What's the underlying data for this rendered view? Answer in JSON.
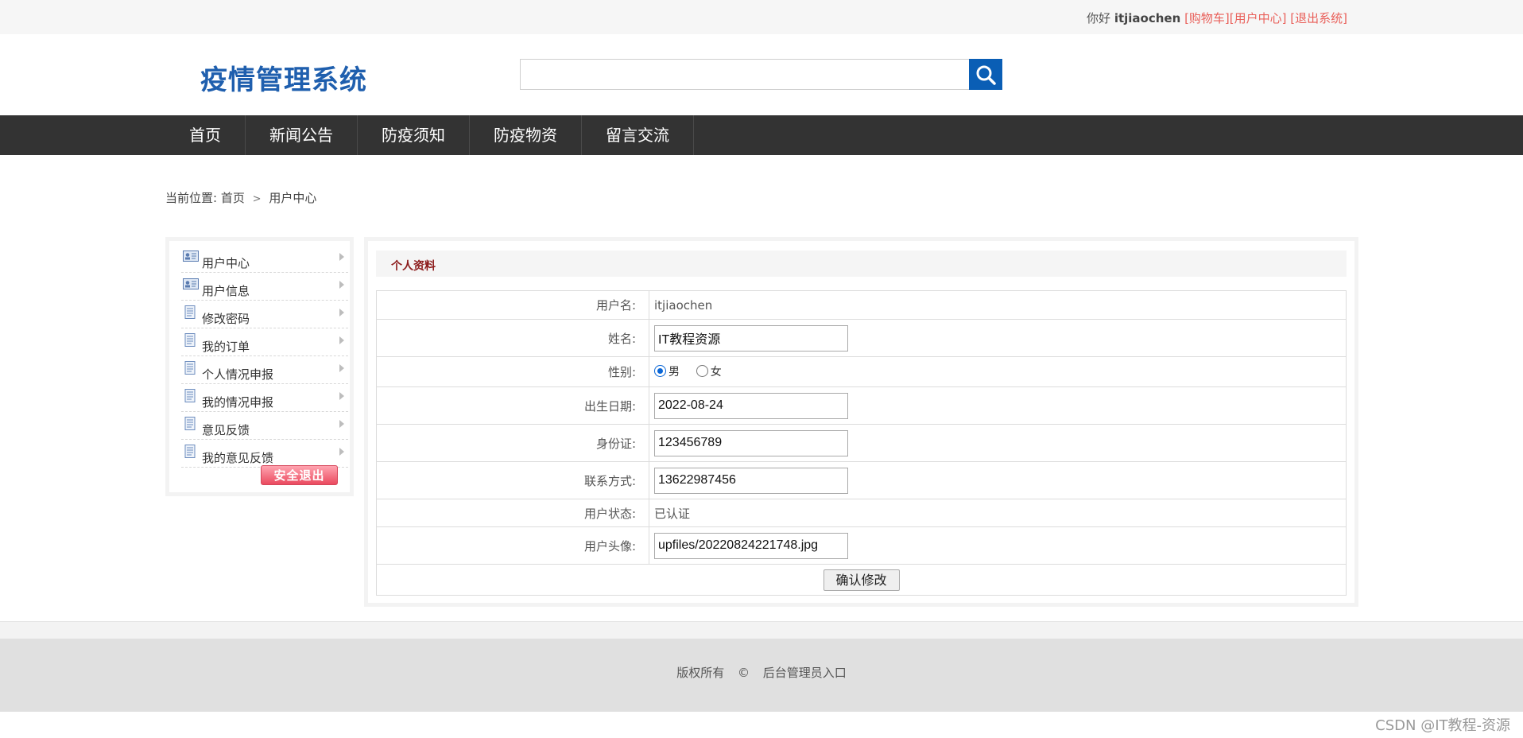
{
  "topbar": {
    "greeting": "你好",
    "username": "itjiaochen",
    "links": [
      "[购物车]",
      "[用户中心]",
      "[退出系统]"
    ]
  },
  "header": {
    "logo": "疫情管理系统",
    "search_placeholder": "",
    "search_icon": "search-icon"
  },
  "nav": {
    "items": [
      "首页",
      "新闻公告",
      "防疫须知",
      "防疫物资",
      "留言交流"
    ]
  },
  "breadcrumb": {
    "prefix": "当前位置:",
    "home": "首页",
    "separator": ">",
    "current": "用户中心"
  },
  "sidebar": {
    "items": [
      {
        "label": "用户中心",
        "icon": "user-card-icon"
      },
      {
        "label": "用户信息",
        "icon": "user-card-icon"
      },
      {
        "label": "修改密码",
        "icon": "document-icon"
      },
      {
        "label": "我的订单",
        "icon": "document-icon"
      },
      {
        "label": "个人情况申报",
        "icon": "document-icon"
      },
      {
        "label": "我的情况申报",
        "icon": "document-icon"
      },
      {
        "label": "意见反馈",
        "icon": "document-icon"
      },
      {
        "label": "我的意见反馈",
        "icon": "document-icon"
      }
    ],
    "logout_label": "安全退出"
  },
  "profile": {
    "title": "个人资料",
    "username_label": "用户名:",
    "username_value": "itjiaochen",
    "name_label": "姓名:",
    "name_value": "IT教程资源",
    "gender_label": "性别:",
    "gender_options": [
      "男",
      "女"
    ],
    "gender_selected": "男",
    "birth_label": "出生日期:",
    "birth_value": "2022-08-24",
    "idcard_label": "身份证:",
    "idcard_value": "123456789",
    "phone_label": "联系方式:",
    "phone_value": "13622987456",
    "status_label": "用户状态:",
    "status_value": "已认证",
    "avatar_label": "用户头像:",
    "avatar_value": "upfiles/20220824221748.jpg",
    "submit_label": "确认修改"
  },
  "footer": {
    "copyright": "版权所有",
    "symbol": "©",
    "admin_link": "后台管理员入口"
  },
  "watermark": "CSDN @IT教程-资源",
  "colors": {
    "brand_blue": "#1f5fae",
    "nav_bg": "#333333",
    "link_red": "#e9605a",
    "panel_title": "#8c1b1b",
    "search_btn": "#0a5eb5"
  }
}
